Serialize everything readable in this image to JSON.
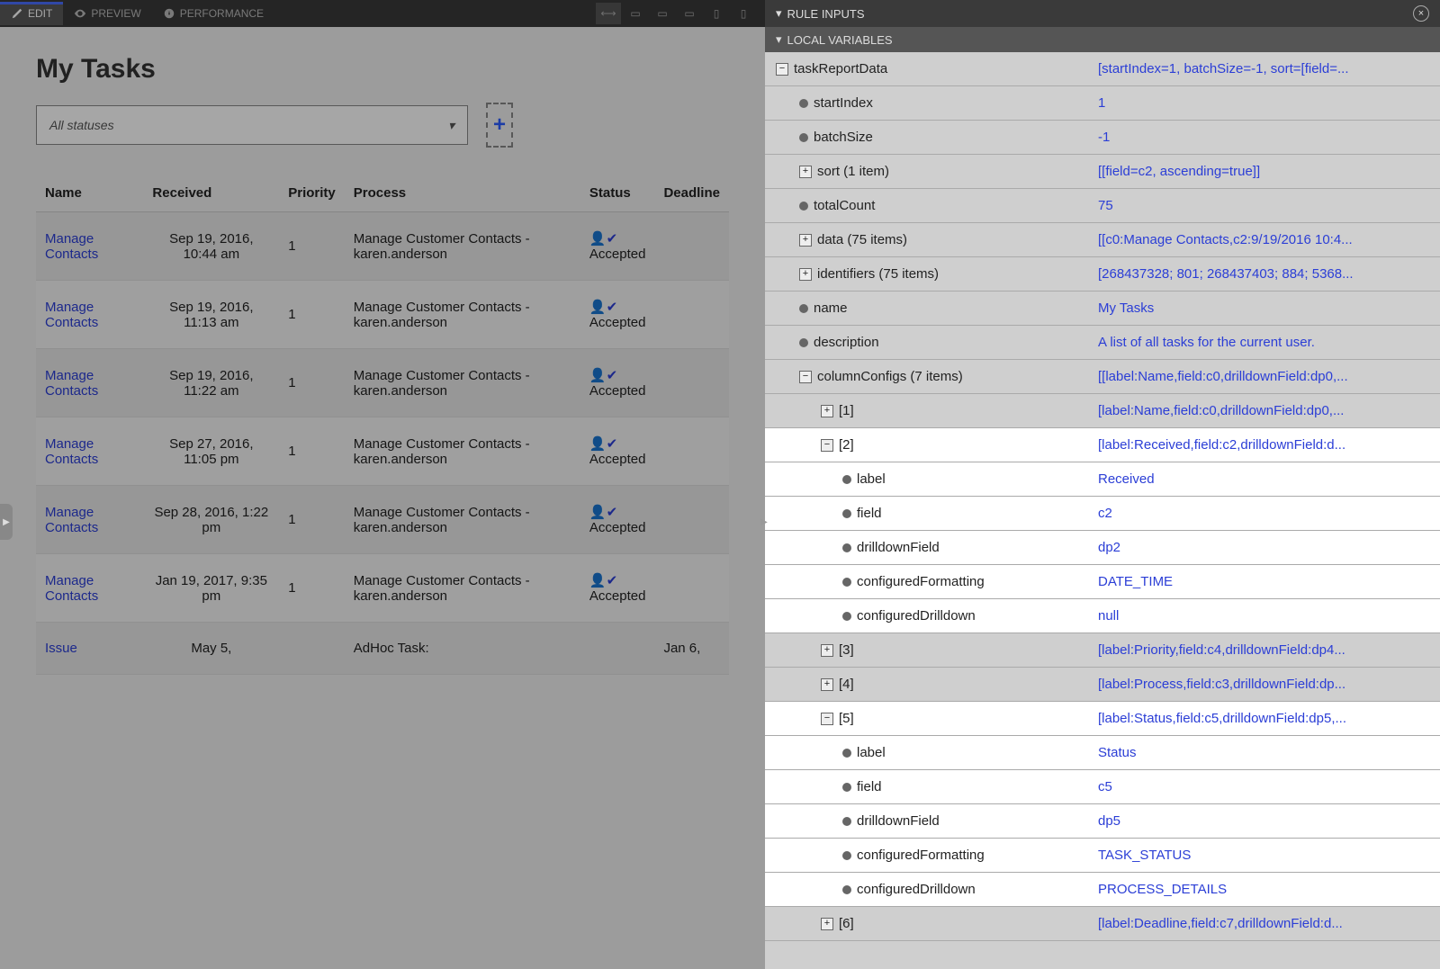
{
  "toolbar": {
    "tabs": [
      {
        "label": "EDIT",
        "active": true
      },
      {
        "label": "PREVIEW",
        "active": false
      },
      {
        "label": "PERFORMANCE",
        "active": false
      }
    ]
  },
  "page": {
    "title": "My Tasks",
    "filterLabel": "All statuses"
  },
  "columns": [
    "Name",
    "Received",
    "Priority",
    "Process",
    "Status",
    "Deadline"
  ],
  "rows": [
    {
      "name": "Manage Contacts",
      "received": "Sep 19, 2016, 10:44 am",
      "priority": "1",
      "process": "Manage Customer Contacts - karen.anderson",
      "status": "Accepted",
      "deadline": ""
    },
    {
      "name": "Manage Contacts",
      "received": "Sep 19, 2016, 11:13 am",
      "priority": "1",
      "process": "Manage Customer Contacts - karen.anderson",
      "status": "Accepted",
      "deadline": ""
    },
    {
      "name": "Manage Contacts",
      "received": "Sep 19, 2016, 11:22 am",
      "priority": "1",
      "process": "Manage Customer Contacts - karen.anderson",
      "status": "Accepted",
      "deadline": ""
    },
    {
      "name": "Manage Contacts",
      "received": "Sep 27, 2016, 11:05 pm",
      "priority": "1",
      "process": "Manage Customer Contacts - karen.anderson",
      "status": "Accepted",
      "deadline": ""
    },
    {
      "name": "Manage Contacts",
      "received": "Sep 28, 2016, 1:22 pm",
      "priority": "1",
      "process": "Manage Customer Contacts - karen.anderson",
      "status": "Accepted",
      "deadline": ""
    },
    {
      "name": "Manage Contacts",
      "received": "Jan 19, 2017, 9:35 pm",
      "priority": "1",
      "process": "Manage Customer Contacts - karen.anderson",
      "status": "Accepted",
      "deadline": ""
    },
    {
      "name": "Issue",
      "received": "May 5,",
      "priority": "",
      "process": "AdHoc Task:",
      "status": "",
      "deadline": "Jan 6,"
    }
  ],
  "rightPanel": {
    "ruleInputsLabel": "RULE INPUTS",
    "localVarsLabel": "LOCAL VARIABLES",
    "vars": [
      {
        "indent": 0,
        "toggle": "minus",
        "name": "taskReportData",
        "value": "[startIndex=1, batchSize=-1, sort=[field=...",
        "bright": false
      },
      {
        "indent": 1,
        "toggle": "bullet",
        "name": "startIndex",
        "value": "1",
        "bright": false
      },
      {
        "indent": 1,
        "toggle": "bullet",
        "name": "batchSize",
        "value": "-1",
        "bright": false
      },
      {
        "indent": 1,
        "toggle": "plus",
        "name": "sort (1 item)",
        "value": "[[field=c2, ascending=true]]",
        "bright": false
      },
      {
        "indent": 1,
        "toggle": "bullet",
        "name": "totalCount",
        "value": "75",
        "bright": false
      },
      {
        "indent": 1,
        "toggle": "plus",
        "name": "data (75 items)",
        "value": "[[c0:Manage Contacts,c2:9/19/2016 10:4...",
        "bright": false
      },
      {
        "indent": 1,
        "toggle": "plus",
        "name": "identifiers (75 items)",
        "value": "[268437328; 801; 268437403; 884; 5368...",
        "bright": false
      },
      {
        "indent": 1,
        "toggle": "bullet",
        "name": "name",
        "value": "My Tasks",
        "bright": false
      },
      {
        "indent": 1,
        "toggle": "bullet",
        "name": "description",
        "value": "A list of all tasks for the current user.",
        "bright": false
      },
      {
        "indent": 1,
        "toggle": "minus",
        "name": "columnConfigs (7 items)",
        "value": "[[label:Name,field:c0,drilldownField:dp0,...",
        "bright": false
      },
      {
        "indent": 2,
        "toggle": "plus",
        "name": "[1]",
        "value": "[label:Name,field:c0,drilldownField:dp0,...",
        "bright": false
      },
      {
        "indent": 2,
        "toggle": "minus",
        "name": "[2]",
        "value": "[label:Received,field:c2,drilldownField:d...",
        "bright": true
      },
      {
        "indent": 3,
        "toggle": "bullet",
        "name": "label",
        "value": "Received",
        "bright": true
      },
      {
        "indent": 3,
        "toggle": "bullet",
        "name": "field",
        "value": "c2",
        "bright": true
      },
      {
        "indent": 3,
        "toggle": "bullet",
        "name": "drilldownField",
        "value": "dp2",
        "bright": true
      },
      {
        "indent": 3,
        "toggle": "bullet",
        "name": "configuredFormatting",
        "value": "DATE_TIME",
        "bright": true
      },
      {
        "indent": 3,
        "toggle": "bullet",
        "name": "configuredDrilldown",
        "value": "null",
        "bright": true
      },
      {
        "indent": 2,
        "toggle": "plus",
        "name": "[3]",
        "value": "[label:Priority,field:c4,drilldownField:dp4...",
        "bright": false
      },
      {
        "indent": 2,
        "toggle": "plus",
        "name": "[4]",
        "value": "[label:Process,field:c3,drilldownField:dp...",
        "bright": false
      },
      {
        "indent": 2,
        "toggle": "minus",
        "name": "[5]",
        "value": "[label:Status,field:c5,drilldownField:dp5,...",
        "bright": true
      },
      {
        "indent": 3,
        "toggle": "bullet",
        "name": "label",
        "value": "Status",
        "bright": true
      },
      {
        "indent": 3,
        "toggle": "bullet",
        "name": "field",
        "value": "c5",
        "bright": true
      },
      {
        "indent": 3,
        "toggle": "bullet",
        "name": "drilldownField",
        "value": "dp5",
        "bright": true
      },
      {
        "indent": 3,
        "toggle": "bullet",
        "name": "configuredFormatting",
        "value": "TASK_STATUS",
        "bright": true
      },
      {
        "indent": 3,
        "toggle": "bullet",
        "name": "configuredDrilldown",
        "value": "PROCESS_DETAILS",
        "bright": true
      },
      {
        "indent": 2,
        "toggle": "plus",
        "name": "[6]",
        "value": "[label:Deadline,field:c7,drilldownField:d...",
        "bright": false
      }
    ]
  }
}
